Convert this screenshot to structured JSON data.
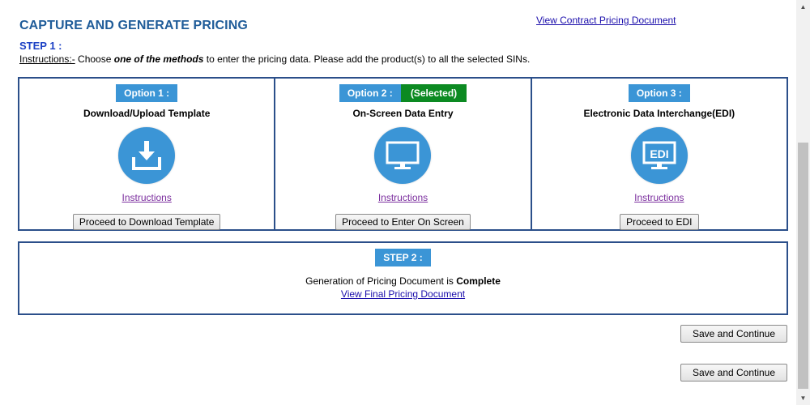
{
  "header": {
    "title": "CAPTURE AND GENERATE PRICING",
    "contract_link": "View Contract Pricing Document"
  },
  "step1": {
    "label": "STEP 1 :",
    "instructions_lead": "Instructions:-",
    "instructions_pre": " Choose ",
    "instructions_emphasis": "one of the methods",
    "instructions_post": " to enter the pricing data. Please add the product(s) to all the selected SINs."
  },
  "options": [
    {
      "badge": "Option 1 :",
      "title": "Download/Upload Template",
      "icon": "download-icon",
      "instructions_link": "Instructions",
      "button": "Proceed to Download Template"
    },
    {
      "badge": "Option 2 :",
      "selected_badge": "(Selected)",
      "title": "On-Screen Data Entry",
      "icon": "monitor-icon",
      "instructions_link": "Instructions",
      "button": "Proceed to Enter On Screen"
    },
    {
      "badge": "Option 3 :",
      "title": "Electronic Data Interchange(EDI)",
      "icon": "edi-monitor-icon",
      "icon_text": "EDI",
      "instructions_link": "Instructions",
      "button": "Proceed to EDI"
    }
  ],
  "step2": {
    "label": "STEP 2 :",
    "status_pre": "Generation of Pricing Document is ",
    "status_value": "Complete",
    "final_link": "View Final Pricing Document"
  },
  "actions": {
    "save_top": "Save and Continue",
    "save_bottom": "Save and Continue"
  },
  "colors": {
    "title": "#1f5c99",
    "badge_blue": "#3b95d6",
    "selected_green": "#0c8a22",
    "box_border": "#2b4f8a",
    "visited_link": "#7b2e9e"
  }
}
